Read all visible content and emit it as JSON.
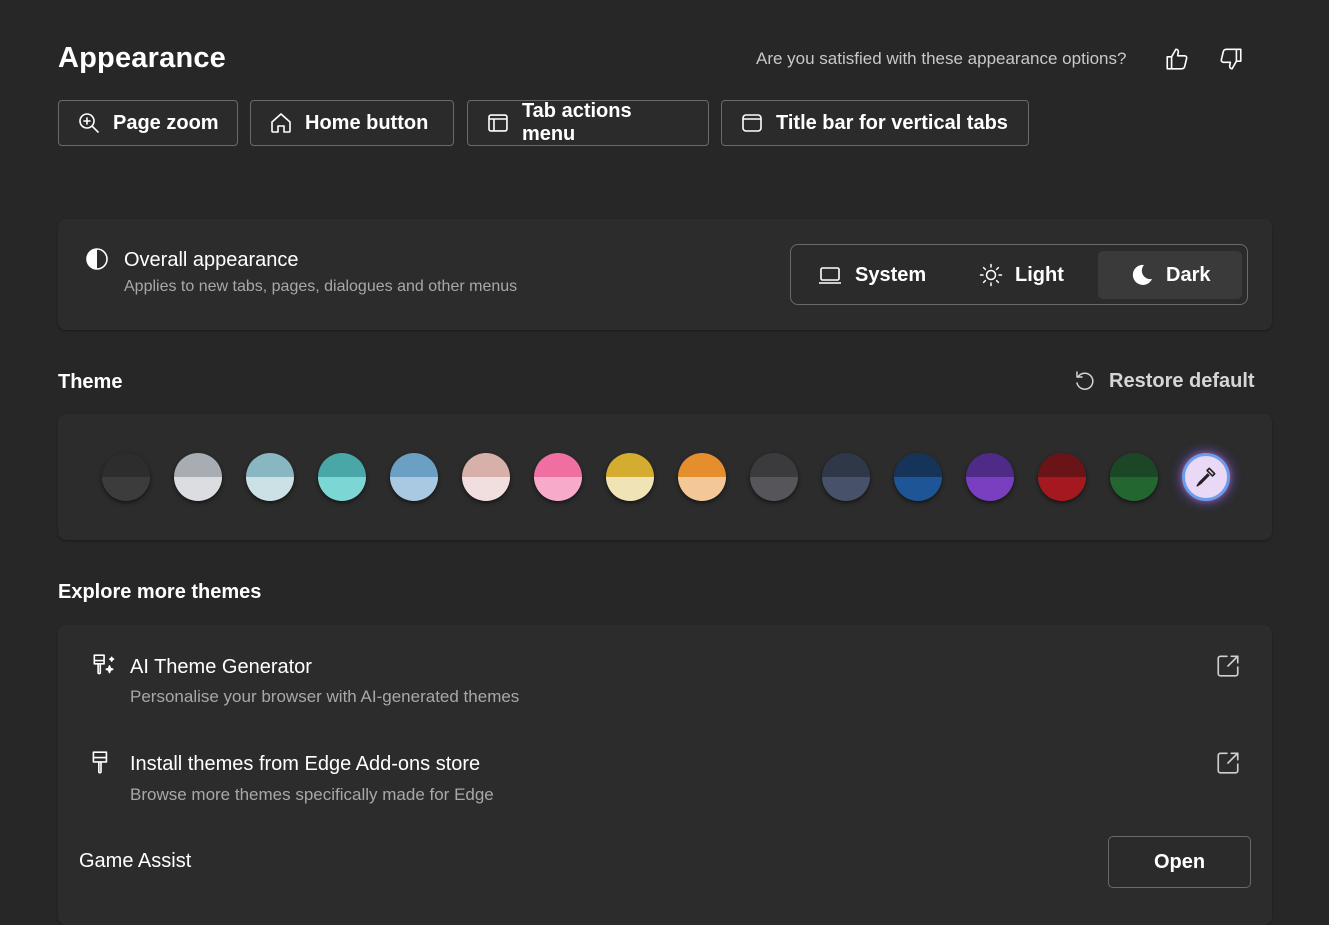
{
  "header": {
    "title": "Appearance",
    "feedback_question": "Are you satisfied with these appearance options?"
  },
  "quick_links": [
    "Page zoom",
    "Home button",
    "Tab actions menu",
    "Title bar for vertical tabs"
  ],
  "overall_appearance": {
    "title": "Overall appearance",
    "subtitle": "Applies to new tabs, pages, dialogues and other menus",
    "options": [
      "System",
      "Light",
      "Dark"
    ],
    "selected": "Dark"
  },
  "theme": {
    "title": "Theme",
    "restore_label": "Restore default",
    "swatches": [
      {
        "top": "#2d2d2d",
        "bottom": "#3c3c3c"
      },
      {
        "top": "#a8adb3",
        "bottom": "#dcdde1"
      },
      {
        "top": "#88b7c2",
        "bottom": "#cce1e6"
      },
      {
        "top": "#4aa7a8",
        "bottom": "#7bd6d4"
      },
      {
        "top": "#6b9fc4",
        "bottom": "#a9c8e2"
      },
      {
        "top": "#d7b0aa",
        "bottom": "#f1dede"
      },
      {
        "top": "#f06fa3",
        "bottom": "#f7aac9"
      },
      {
        "top": "#d4ac2f",
        "bottom": "#f0e3b6"
      },
      {
        "top": "#e58e2e",
        "bottom": "#f4c896"
      },
      {
        "top": "#3b3b3d",
        "bottom": "#56565a"
      },
      {
        "top": "#2f3848",
        "bottom": "#47526a"
      },
      {
        "top": "#163359",
        "bottom": "#1e5596"
      },
      {
        "top": "#4e2b86",
        "bottom": "#7a3fc1"
      },
      {
        "top": "#6a1417",
        "bottom": "#a6181f"
      },
      {
        "top": "#1c4726",
        "bottom": "#246630"
      }
    ],
    "custom_label": "custom-color-picker"
  },
  "explore": {
    "title": "Explore more themes",
    "items": [
      {
        "title": "AI Theme Generator",
        "subtitle": "Personalise your browser with AI-generated themes"
      },
      {
        "title": "Install themes from Edge Add-ons store",
        "subtitle": "Browse more themes specifically made for Edge"
      }
    ]
  },
  "game_assist": {
    "label": "Game Assist",
    "button": "Open"
  },
  "colors": {
    "background": "#272727",
    "card": "#2c2c2c",
    "border": "#6a6a6a",
    "subtext": "#a8a8a8"
  }
}
